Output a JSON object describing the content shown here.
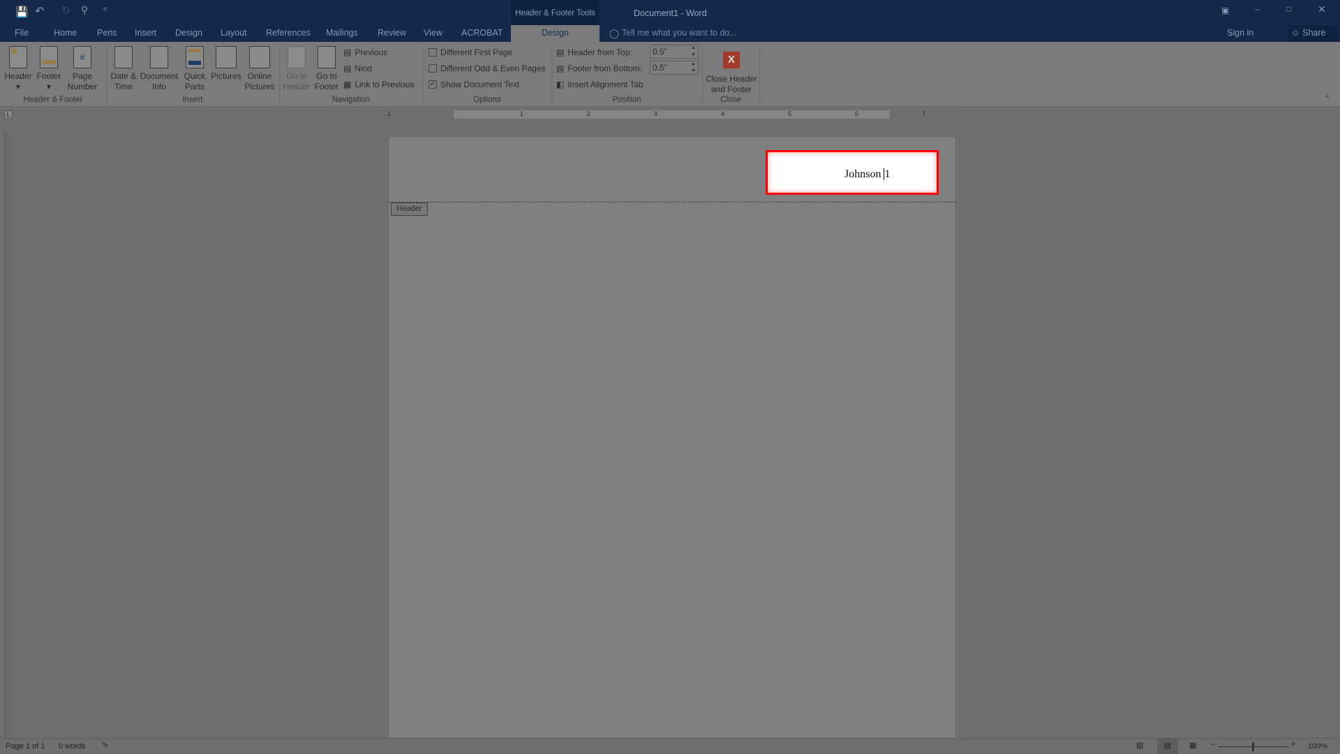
{
  "titlebar": {
    "title": "Document1 - Word",
    "context_tab_group": "Header & Footer Tools",
    "sign_in": "Sign in",
    "share": "Share"
  },
  "tabs": [
    "File",
    "Home",
    "Pens",
    "Insert",
    "Design",
    "Layout",
    "References",
    "Mailings",
    "Review",
    "View",
    "ACROBAT"
  ],
  "active_tab": "Design",
  "tell_me": "Tell me what you want to do...",
  "ribbon": {
    "header_footer": {
      "header": "Header",
      "footer": "Footer",
      "page_number_1": "Page",
      "page_number_2": "Number",
      "group": "Header & Footer"
    },
    "insert": {
      "date_1": "Date &",
      "date_2": "Time",
      "docinfo_1": "Document",
      "docinfo_2": "Info",
      "quick_1": "Quick",
      "quick_2": "Parts",
      "pictures": "Pictures",
      "online_1": "Online",
      "online_2": "Pictures",
      "group": "Insert"
    },
    "navigation": {
      "goto_header_1": "Go to",
      "goto_header_2": "Header",
      "goto_footer_1": "Go to",
      "goto_footer_2": "Footer",
      "previous": "Previous",
      "next": "Next",
      "link_previous": "Link to Previous",
      "group": "Navigation"
    },
    "options": {
      "diff_first": "Different First Page",
      "diff_odd_even": "Different Odd & Even Pages",
      "show_doc_text": "Show Document Text",
      "show_doc_text_checked": true,
      "group": "Options"
    },
    "position": {
      "header_top_label": "Header from Top:",
      "header_top_value": "0.5\"",
      "footer_bottom_label": "Footer from Bottom:",
      "footer_bottom_value": "0.5\"",
      "align_tab": "Insert Alignment Tab",
      "group": "Position"
    },
    "close": {
      "label_1": "Close Header",
      "label_2": "and Footer",
      "group": "Close"
    }
  },
  "ruler": {
    "labels": [
      "1",
      "1",
      "2",
      "3",
      "4",
      "5",
      "6",
      "7"
    ]
  },
  "document": {
    "header_tag": "Header",
    "header_text": "Johnson ",
    "page_number": "1",
    "highlight_color": "#ff0000"
  },
  "status": {
    "page": "Page 1 of 1",
    "words": "0 words",
    "zoom": "100%"
  },
  "colors": {
    "titlebar": "#13294b",
    "close_icon": "#a33a2c"
  }
}
